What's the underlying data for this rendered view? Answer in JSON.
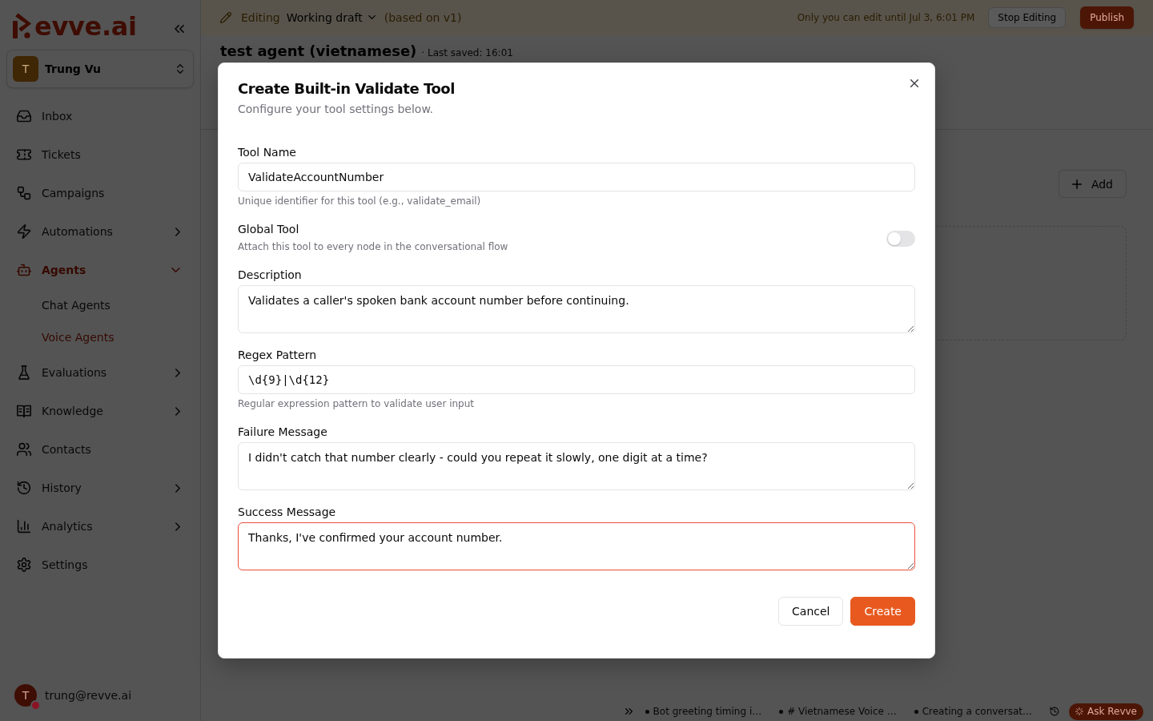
{
  "sidebar": {
    "brand": "evve.ai",
    "workspace": {
      "initial": "T",
      "name": "Trung Vu"
    },
    "items": [
      {
        "label": "Inbox",
        "kind": "link",
        "selected": false
      },
      {
        "label": "Tickets",
        "kind": "link",
        "selected": false
      },
      {
        "label": "Campaigns",
        "kind": "link",
        "selected": false
      },
      {
        "label": "Automations",
        "kind": "group",
        "expanded": false,
        "selected": false
      },
      {
        "label": "Agents",
        "kind": "group",
        "expanded": true,
        "selected": true,
        "children": [
          {
            "label": "Chat Agents",
            "selected": false
          },
          {
            "label": "Voice Agents",
            "selected": true
          }
        ]
      },
      {
        "label": "Evaluations",
        "kind": "group",
        "expanded": false,
        "selected": false
      },
      {
        "label": "Knowledge",
        "kind": "group",
        "expanded": false,
        "selected": false
      },
      {
        "label": "Contacts",
        "kind": "link",
        "selected": false
      },
      {
        "label": "History",
        "kind": "group",
        "expanded": false,
        "selected": false
      },
      {
        "label": "Analytics",
        "kind": "group",
        "expanded": false,
        "selected": false
      },
      {
        "label": "Settings",
        "kind": "link",
        "selected": false
      }
    ],
    "user": {
      "initial": "T",
      "email": "trung@revve.ai"
    }
  },
  "edit_bar": {
    "mode": "Editing",
    "version": "Working draft",
    "based_on": "(based on v1)",
    "notice": "Only you can edit until Jul 3, 6:01 PM",
    "buttons": [
      {
        "label": "Stop Editing",
        "kind": "outline"
      },
      {
        "label": "Publish",
        "kind": "primary"
      }
    ]
  },
  "page": {
    "title": "test agent (vietnamese)",
    "saved": "· Last saved: 16:01",
    "add_button": "Add"
  },
  "chat_bar": {
    "tabs": [
      {
        "label": "Bot greeting timing i…"
      },
      {
        "label": "# Vietnamese Voice …"
      },
      {
        "label": "Creating a conversat…"
      }
    ],
    "assistant": "Ask Revve"
  },
  "dialog": {
    "title": "Create Built-in Validate Tool",
    "subtitle": "Configure your tool settings below.",
    "fields": [
      {
        "kind": "text",
        "label": "Tool Name",
        "value": "ValidateAccountNumber",
        "help": "Unique identifier for this tool (e.g., validate_email)",
        "focused": false
      },
      {
        "kind": "toggle",
        "label": "Global Tool",
        "help": "Attach this tool to every node in the conversational flow",
        "on": false
      },
      {
        "kind": "textarea",
        "label": "Description",
        "value": "Validates a caller's spoken bank account number before continuing.",
        "focused": false
      },
      {
        "kind": "code",
        "label": "Regex Pattern",
        "value": "\\d{9}|\\d{12}",
        "help": "Regular expression pattern to validate user input",
        "focused": false
      },
      {
        "kind": "textarea",
        "label": "Failure Message",
        "value": "I didn't catch that number clearly - could you repeat it slowly, one digit at a time?",
        "focused": false
      },
      {
        "kind": "textarea",
        "label": "Success Message",
        "value": "Thanks, I've confirmed your account number.",
        "focused": true
      }
    ],
    "buttons": [
      {
        "label": "Cancel",
        "kind": "secondary"
      },
      {
        "label": "Create",
        "kind": "primary"
      }
    ]
  }
}
